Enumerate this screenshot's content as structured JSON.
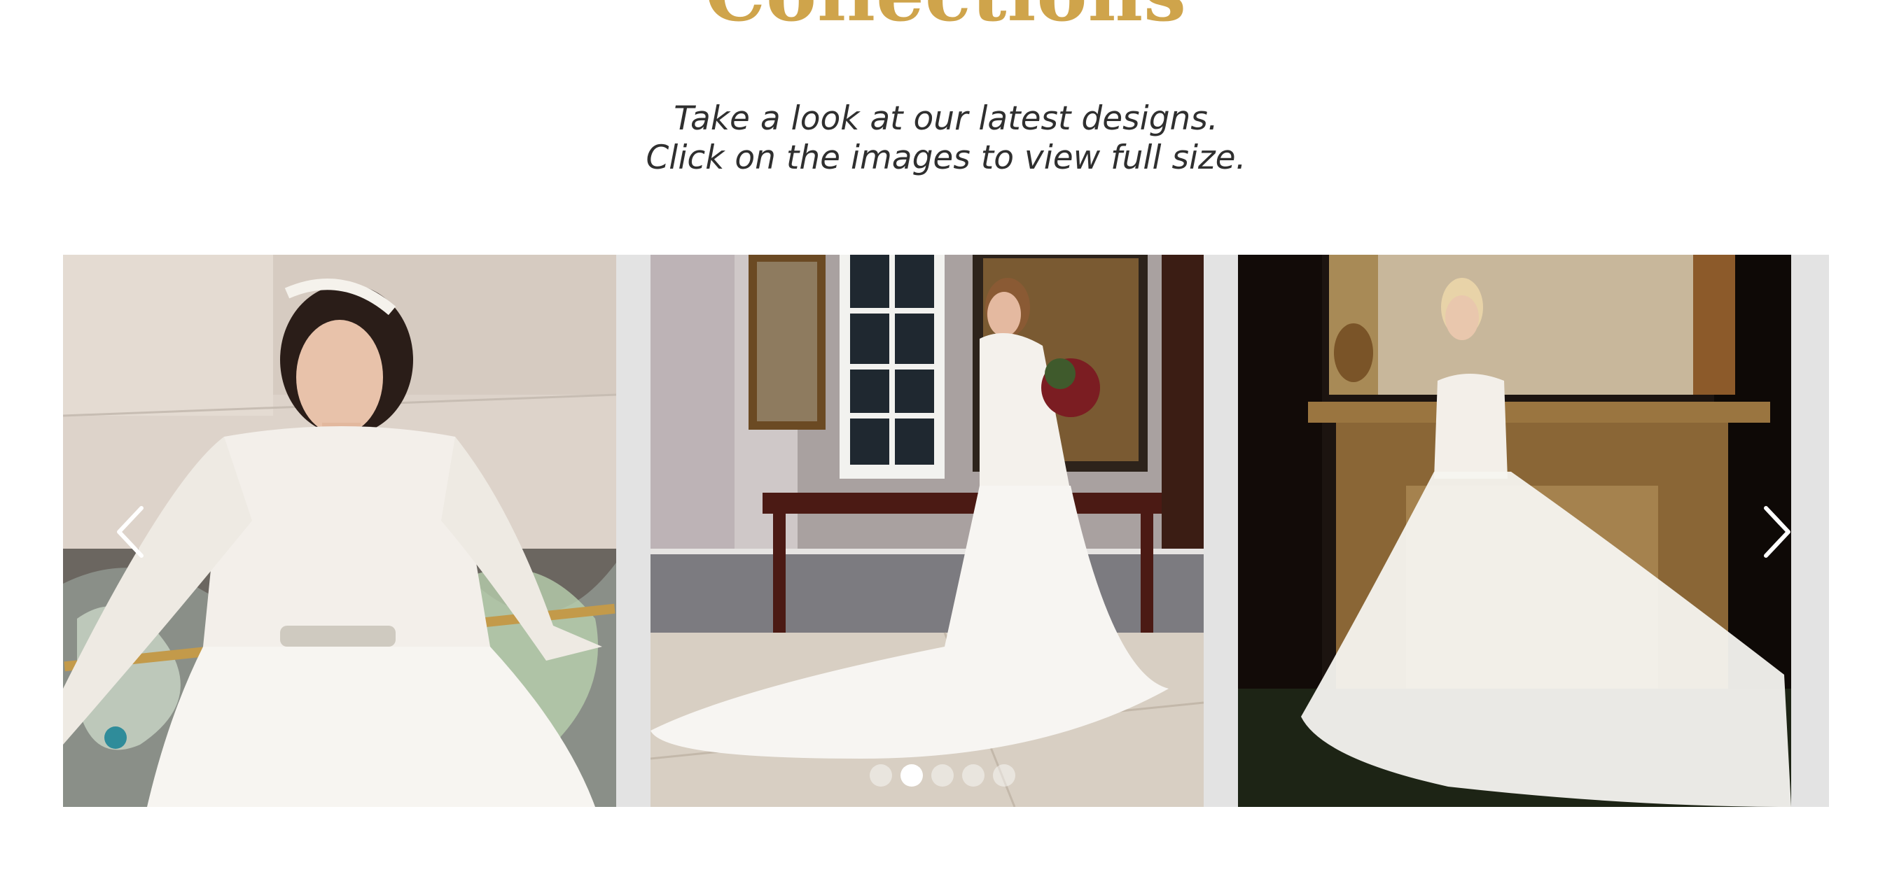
{
  "section": {
    "title": "Collections",
    "subtitle_line1": "Take a look at our latest designs.",
    "subtitle_line2": "Click on the images to view full size."
  },
  "carousel": {
    "slides": [
      {
        "icon": "bride-lace-sleeves-photo"
      },
      {
        "icon": "bride-train-hall-photo"
      },
      {
        "icon": "bride-fireplace-gown-photo"
      }
    ],
    "prev_icon": "chevron-left-icon",
    "next_icon": "chevron-right-icon",
    "dot_count": 5,
    "active_dot": 2
  },
  "colors": {
    "accent": "#cfa44b",
    "text": "#2f2f2f",
    "carousel_bg": "#e3e3e3"
  }
}
